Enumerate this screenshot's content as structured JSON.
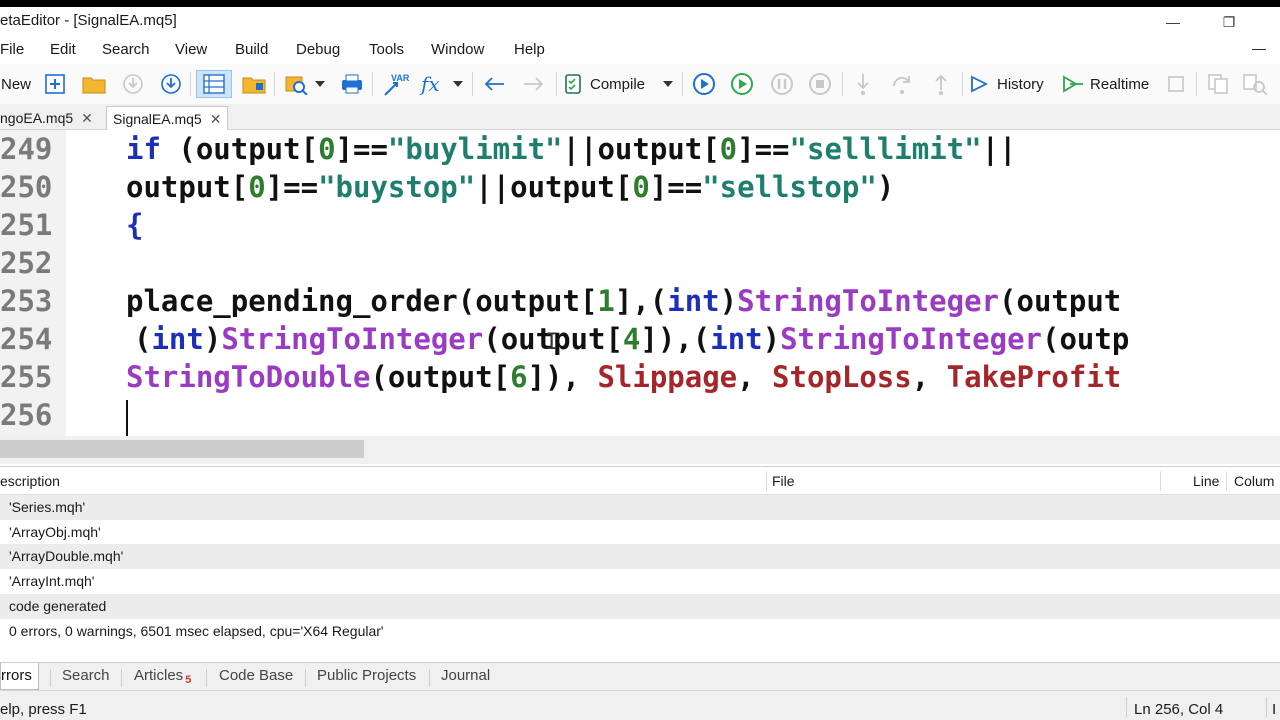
{
  "window": {
    "title": "etaEditor - [SignalEA.mq5]",
    "minimize_glyph": "—",
    "restore_glyph": "❐"
  },
  "menu": {
    "items": [
      "File",
      "Edit",
      "Search",
      "View",
      "Build",
      "Debug",
      "Tools",
      "Window",
      "Help"
    ],
    "minimize_glyph": "—"
  },
  "toolbar": {
    "new_label": "New",
    "compile_label": "Compile",
    "history_label": "History",
    "realtime_label": "Realtime",
    "var_label": "VAR",
    "fx_label": "fx",
    "colors": {
      "accent_blue": "#1e6fd0",
      "play_green": "#2eaa4a",
      "folder_yellow": "#f2b630"
    }
  },
  "tabs": [
    {
      "label": "ngoEA.mq5",
      "close": "✕",
      "active": false
    },
    {
      "label": "SignalEA.mq5",
      "close": "✕",
      "active": true
    }
  ],
  "editor": {
    "line_numbers": [
      "249",
      "250",
      "251",
      "252",
      "253",
      "254",
      "255",
      "256"
    ],
    "cursor": "Ln 256, Col 4"
  },
  "errors_panel": {
    "columns": {
      "description": "escription",
      "file": "File",
      "line": "Line",
      "column": "Colum"
    },
    "rows": [
      "'Series.mqh'",
      "'ArrayObj.mqh'",
      "'ArrayDouble.mqh'",
      "'ArrayInt.mqh'",
      "code generated",
      "0 errors, 0 warnings, 6501 msec elapsed, cpu='X64 Regular'"
    ]
  },
  "bottom_tabs": {
    "errors": "rrors",
    "search": "Search",
    "articles": "Articles",
    "articles_badge": "5",
    "code_base": "Code Base",
    "public_projects": "Public Projects",
    "journal": "Journal"
  },
  "statusbar": {
    "help": "elp, press F1",
    "position": "Ln 256, Col 4",
    "extra": "I"
  }
}
